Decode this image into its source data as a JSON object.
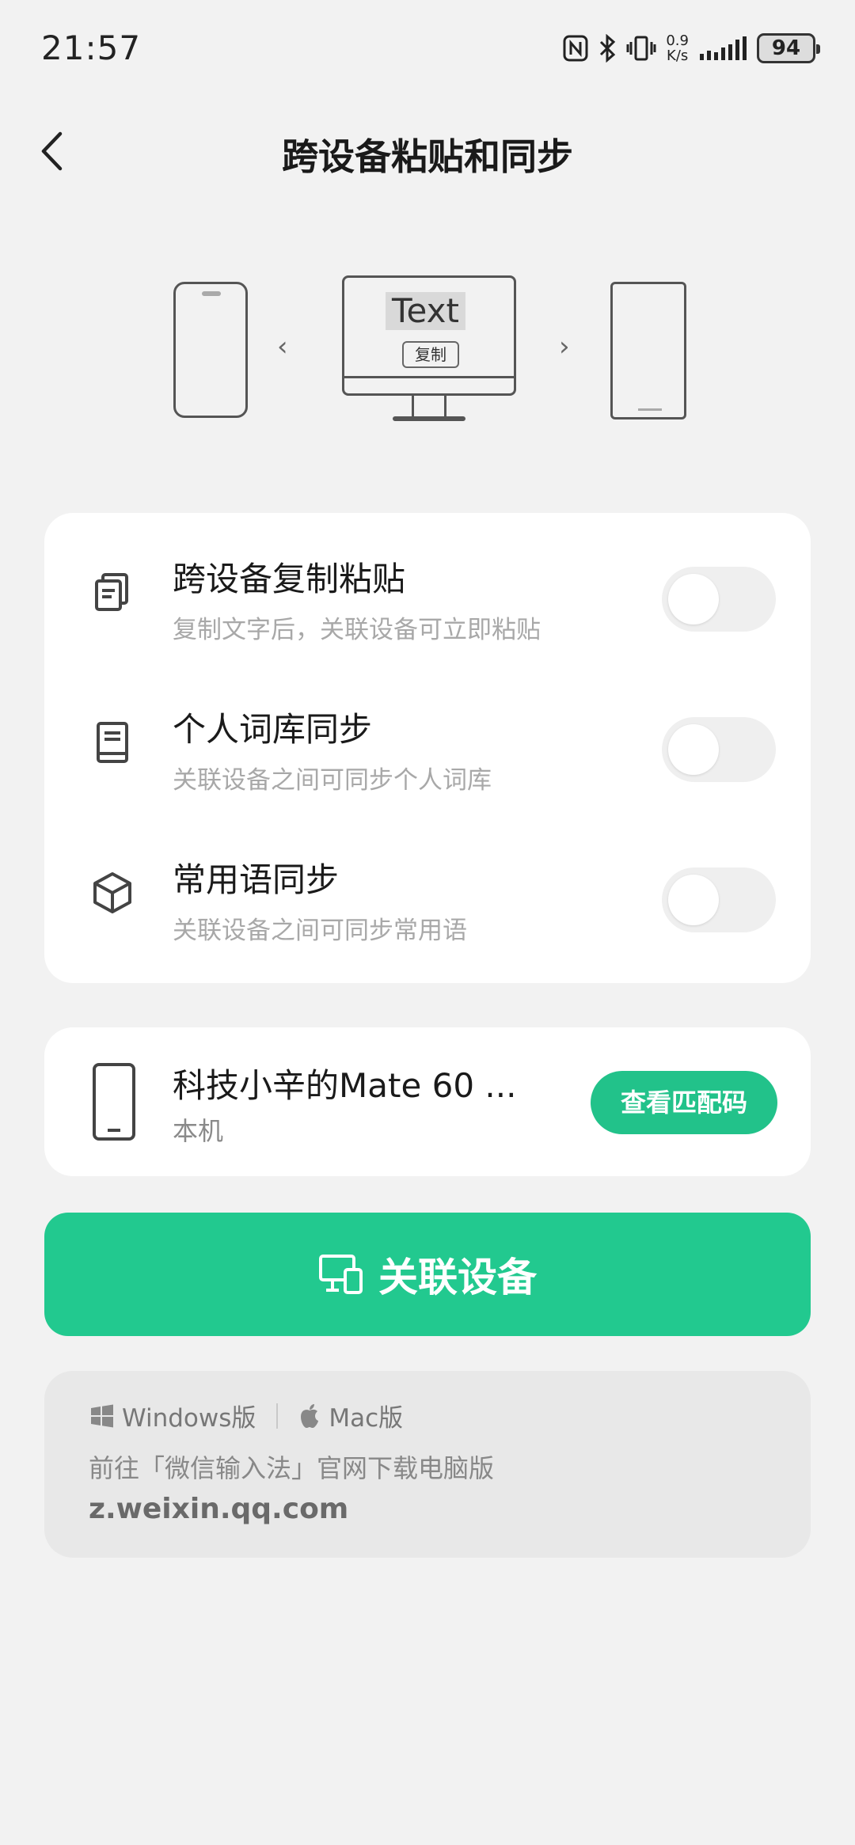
{
  "status_bar": {
    "time": "21:57",
    "net_speed_value": "0.9",
    "net_speed_unit": "K/s",
    "battery": "94",
    "icons": [
      "nfc-icon",
      "bluetooth-icon",
      "vibrate-icon",
      "signal-icon"
    ]
  },
  "header": {
    "title": "跨设备粘贴和同步",
    "back_icon": "chevron-left-icon"
  },
  "illustration": {
    "monitor_text": "Text",
    "copy_label": "复制"
  },
  "settings": [
    {
      "title": "跨设备复制粘贴",
      "subtitle": "复制文字后，关联设备可立即粘贴",
      "icon": "copy-icon",
      "enabled": false
    },
    {
      "title": "个人词库同步",
      "subtitle": "关联设备之间可同步个人词库",
      "icon": "book-icon",
      "enabled": false
    },
    {
      "title": "常用语同步",
      "subtitle": "关联设备之间可同步常用语",
      "icon": "cube-icon",
      "enabled": false
    }
  ],
  "device": {
    "name": "科技小辛的Mate 60 ...",
    "subtitle": "本机",
    "icon": "phone-icon",
    "button_label": "查看匹配码"
  },
  "link_button": {
    "label": "关联设备",
    "icon": "devices-icon"
  },
  "download": {
    "windows_label": "Windows版",
    "mac_label": "Mac版",
    "hint": "前往「微信输入法」官网下载电脑版",
    "url": "z.weixin.qq.com"
  },
  "colors": {
    "accent": "#22c98f",
    "background": "#f2f2f2",
    "card": "#ffffff"
  }
}
